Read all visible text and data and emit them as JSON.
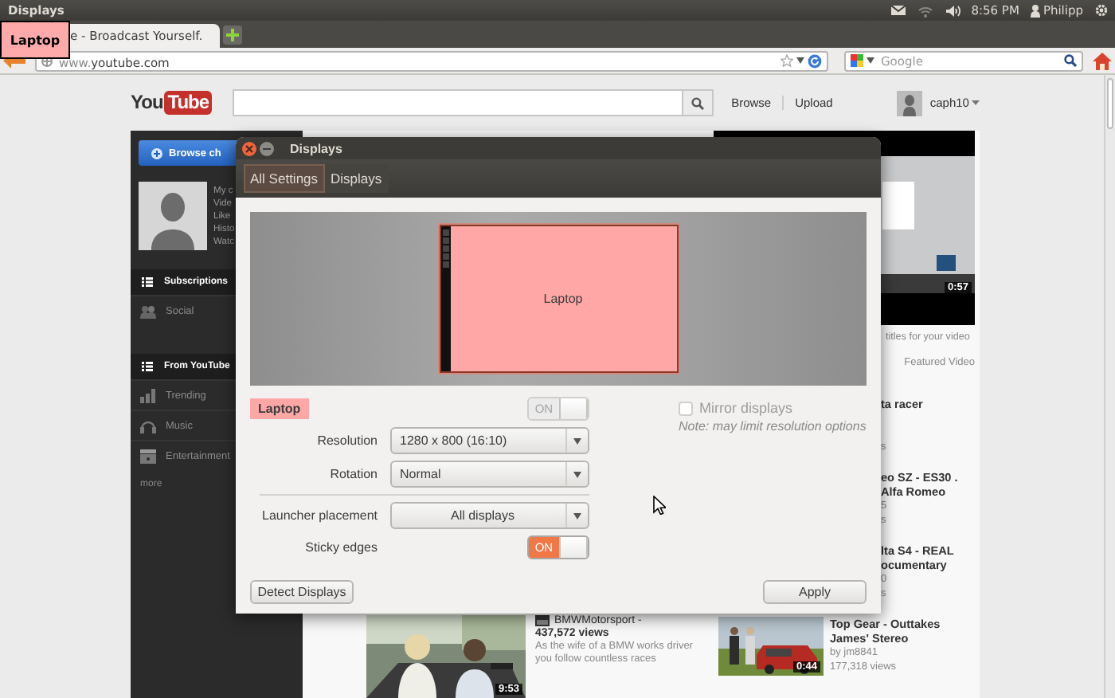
{
  "top_panel": {
    "title": "Displays",
    "clock": "8:56 PM",
    "user": "Philipp"
  },
  "browser": {
    "tabs": [
      {
        "title": "e - Broadcast Yourself.",
        "selected": true
      }
    ],
    "address": {
      "prefix": "www.",
      "domain": "youtube.com"
    },
    "search": {
      "placeholder": "Google"
    }
  },
  "youtube": {
    "logo": {
      "left": "You",
      "right": "Tube"
    },
    "nav_links": [
      "Browse",
      "Upload"
    ],
    "user": "caph10",
    "sidebar": {
      "button": "Browse ch",
      "profile_links": [
        "My c",
        "Vide",
        "Like",
        "Histo",
        "Watc"
      ],
      "sections": [
        {
          "title": "Subscriptions",
          "items": [
            {
              "label": "Social",
              "kind": "social"
            }
          ]
        },
        {
          "title": "From YouTube",
          "items": [
            {
              "label": "Trending",
              "kind": "trending"
            },
            {
              "label": "Music",
              "kind": "music"
            },
            {
              "label": "Entertainment",
              "kind": "entertainment"
            }
          ]
        }
      ],
      "more": "more"
    },
    "main_video": {
      "channel": "BMWMotorsport -",
      "views": "437,572 views",
      "description": "As the wife of a BMW works driver you follow countless races",
      "duration": "9:53"
    },
    "featured": {
      "duration": "0:57",
      "caption": "titles for your video",
      "label": "Featured Video"
    },
    "videos": [
      {
        "title": [
          "ta racer"
        ],
        "meta": [
          "s"
        ]
      },
      {
        "title": [
          "eo SZ - ES30 .",
          "Alfa Romeo"
        ],
        "meta": [
          "5",
          "s"
        ]
      },
      {
        "title": [
          "lta S4 - REAL",
          "ocumentary"
        ],
        "meta": [
          "0",
          "s"
        ]
      },
      {
        "title": [
          "Top Gear - Outtakes",
          "James' Stereo"
        ],
        "meta": [
          "by jm8841",
          "177,318 views"
        ],
        "duration": "0:44"
      }
    ]
  },
  "overlay_label": "Laptop",
  "dialog": {
    "title": "Displays",
    "crumbs": [
      {
        "label": "All Settings",
        "selected": true
      },
      {
        "label": "Displays",
        "selected": false
      }
    ],
    "monitor_label": "Laptop",
    "display_name": "Laptop",
    "display_switch": {
      "label": "ON",
      "on": true,
      "disabled": true
    },
    "mirror": {
      "label": "Mirror displays",
      "checked": false,
      "disabled": true
    },
    "note": "Note: may limit resolution options",
    "fields": [
      {
        "label": "Resolution",
        "value": "1280 x 800 (16:10)"
      },
      {
        "label": "Rotation",
        "value": "Normal"
      }
    ],
    "launcher": {
      "label": "Launcher placement",
      "value": "All displays"
    },
    "sticky": {
      "label": "Sticky edges",
      "switch": {
        "label": "ON",
        "on": true,
        "disabled": false
      }
    },
    "buttons": [
      "Detect Displays",
      "Apply"
    ]
  }
}
